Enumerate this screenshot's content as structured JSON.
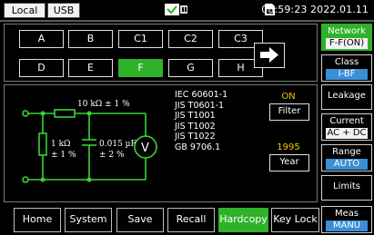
{
  "status": {
    "tab_local": "Local",
    "tab_usb": "USB",
    "clock": "08:59:23 2022.01.11"
  },
  "grid": [
    [
      "A",
      "B",
      "C1",
      "C2",
      "C3"
    ],
    [
      "D",
      "E",
      "F",
      "G",
      "H"
    ]
  ],
  "active_cell": "F",
  "circuit": {
    "r_top": "10 kΩ ± 1 %",
    "r_left_value": "1 kΩ",
    "r_left_tol": "± 1 %",
    "cap_value": "0.015 µF",
    "cap_tol": "± 2 %",
    "meter": "V"
  },
  "standards": [
    "IEC 60601-1",
    "JIS T0601-1",
    "JIS T1001",
    "JIS T1002",
    "JIS T1022",
    "GB 9706.1"
  ],
  "filter": {
    "state": "ON",
    "label": "Filter"
  },
  "year": {
    "value": "1995",
    "label": "Year"
  },
  "right_panel": {
    "network": {
      "label": "Network",
      "value": "F-F(ON)"
    },
    "class": {
      "label": "Class",
      "value": "I-BF"
    },
    "leakage": {
      "label": "Leakage"
    },
    "current": {
      "label": "Current",
      "value": "AC + DC"
    },
    "range": {
      "label": "Range",
      "value": "AUTO"
    },
    "limits": {
      "label": "Limits"
    },
    "meas": {
      "label": "Meas",
      "value": "MANU"
    }
  },
  "bottom": [
    "Home",
    "System",
    "Save",
    "Recall",
    "Hardcopy",
    "Key Lock"
  ],
  "active_bottom": "Hardcopy",
  "colors": {
    "accent_green": "#2fb12a",
    "circuit_green": "#3bd13b",
    "highlight_yellow": "#f5c400",
    "blue": "#3a8fd6"
  }
}
